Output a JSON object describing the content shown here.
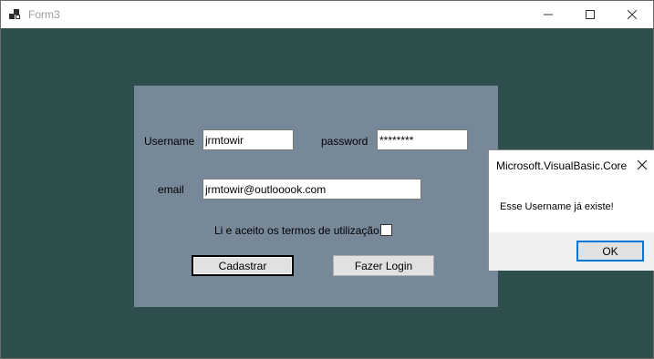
{
  "window": {
    "title": "Form3",
    "colors": {
      "background": "#2f4f4f",
      "panel": "#778899"
    }
  },
  "icons": {
    "app": "form-app-icon",
    "minimize": "minimize-icon",
    "maximize": "maximize-icon",
    "close": "close-icon"
  },
  "form": {
    "username_label": "Username",
    "username_value": "jrmtowir",
    "password_label": "password",
    "password_value": "********",
    "email_label": "email",
    "email_value": "jrmtowir@outlooook.com",
    "terms_label": "Li e aceito os termos de utilização",
    "terms_checked": false,
    "register_label": "Cadastrar",
    "login_label": "Fazer Login"
  },
  "message_box": {
    "title": "Microsoft.VisualBasic.Core",
    "message": "Esse Username já existe!",
    "ok_label": "OK"
  }
}
